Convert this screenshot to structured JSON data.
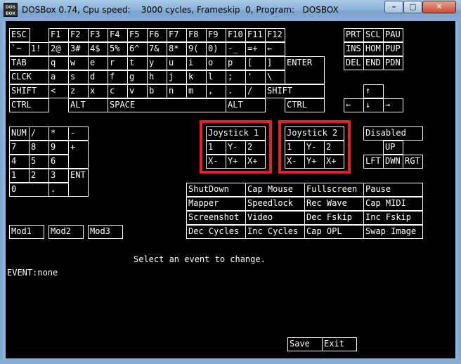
{
  "window": {
    "title": "DOSBox 0.74, Cpu speed:    3000 cycles, Frameskip  0, Program:   DOSBOX",
    "icon_text": "DOS BOX",
    "minimize": "–",
    "maximize": "▢",
    "close": "✕"
  },
  "keyboard": {
    "row_fn": [
      "ESC",
      "F1",
      "F2",
      "F3",
      "F4",
      "F5",
      "F6",
      "F7",
      "F8",
      "F9",
      "F10",
      "F11",
      "F12"
    ],
    "row_num": [
      "`~",
      "1!",
      "2@",
      "3#",
      "4$",
      "5%",
      "6^",
      "7&",
      "8*",
      "9(",
      "0)",
      "-_",
      "=+",
      "←"
    ],
    "row_tab": [
      "TAB",
      "q",
      "w",
      "e",
      "r",
      "t",
      "y",
      "u",
      "i",
      "o",
      "p",
      "[",
      "]",
      "ENTER"
    ],
    "row_caps": [
      "CLCK",
      "a",
      "s",
      "d",
      "f",
      "g",
      "h",
      "j",
      "k",
      "l",
      ";",
      "'",
      "\\"
    ],
    "row_shift": [
      "SHIFT",
      "<",
      "z",
      "x",
      "c",
      "v",
      "b",
      "n",
      "m",
      ",",
      ".",
      "/",
      "SHIFT"
    ],
    "row_ctrl": [
      "CTRL",
      "ALT",
      "SPACE",
      "ALT",
      "CTRL"
    ],
    "nav_block": [
      "PRT",
      "SCL",
      "PAU",
      "INS",
      "HOM",
      "PUP",
      "DEL",
      "END",
      "PDN"
    ],
    "arrows": [
      "↑",
      "←",
      "↓",
      "→"
    ],
    "numpad": [
      "NUM",
      "/",
      "*",
      "-",
      "7",
      "8",
      "9",
      "+",
      "4",
      "5",
      "6",
      "1",
      "2",
      "3",
      "ENT",
      "0",
      "."
    ]
  },
  "joystick1": {
    "title": "Joystick 1",
    "keys": [
      "1",
      "Y-",
      "2",
      "X-",
      "Y+",
      "X+"
    ]
  },
  "joystick2": {
    "title": "Joystick 2",
    "keys": [
      "1",
      "Y-",
      "2",
      "X-",
      "Y+",
      "X+"
    ]
  },
  "hat": {
    "disabled": "Disabled",
    "up": "UP",
    "left": "LFT",
    "down": "DWN",
    "right": "RGT"
  },
  "actions": [
    "ShutDown",
    "Cap Mouse",
    "Fullscreen",
    "Pause",
    "Mapper",
    "Speedlock",
    "Rec Wave",
    "Cap MIDI",
    "Screenshot",
    "Video",
    "Dec Fskip",
    "Inc Fskip",
    "Dec Cycles",
    "Inc Cycles",
    "Cap OPL",
    "Swap Image"
  ],
  "mods": [
    "Mod1",
    "Mod2",
    "Mod3"
  ],
  "status": {
    "message": "Select an event to change.",
    "event": "EVENT:none"
  },
  "footer": {
    "save": "Save",
    "exit": "Exit"
  },
  "colors": {
    "highlight": "#e0202a",
    "screen_bg": "#000000",
    "fg": "#ffffff"
  }
}
